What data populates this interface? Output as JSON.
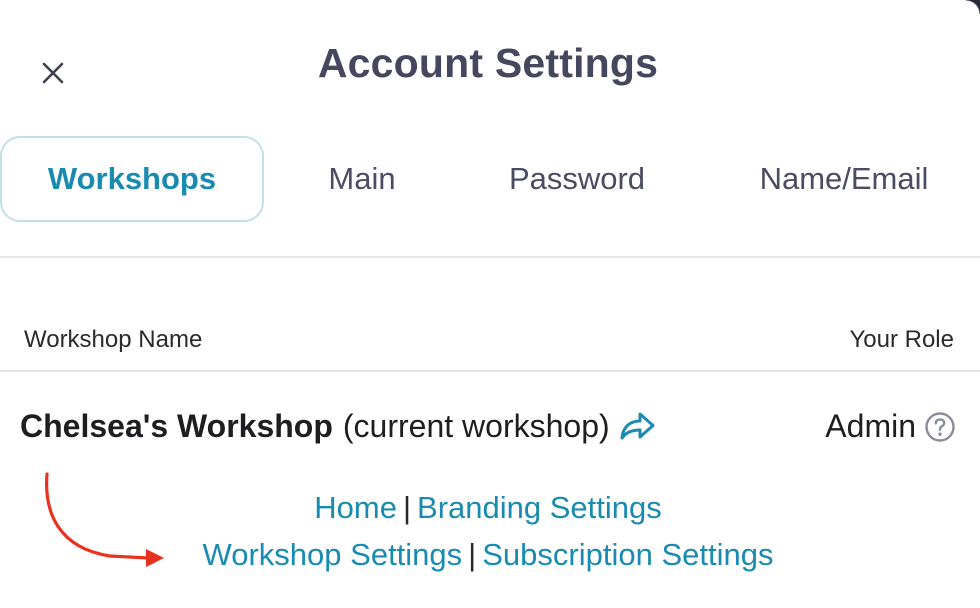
{
  "modal": {
    "title": "Account Settings",
    "close_icon": "close-icon"
  },
  "tabs": [
    {
      "label": "Workshops",
      "active": true
    },
    {
      "label": "Main",
      "active": false
    },
    {
      "label": "Password",
      "active": false
    },
    {
      "label": "Name/Email",
      "active": false
    }
  ],
  "table": {
    "col_name": "Workshop Name",
    "col_role": "Your Role",
    "rows": [
      {
        "name": "Chelsea's Workshop",
        "suffix": "(current workshop)",
        "role": "Admin",
        "icons": [
          "share-arrow-icon",
          "help-circle-icon"
        ],
        "links_line1": [
          "Home",
          "Branding Settings"
        ],
        "links_line2": [
          "Workshop Settings",
          "Subscription Settings"
        ],
        "separator": "|"
      }
    ]
  },
  "colors": {
    "title": "#45475f",
    "accent": "#1a8bb0",
    "active_tab_border": "#c3e0e6",
    "annotation_arrow": "#e8321e"
  }
}
